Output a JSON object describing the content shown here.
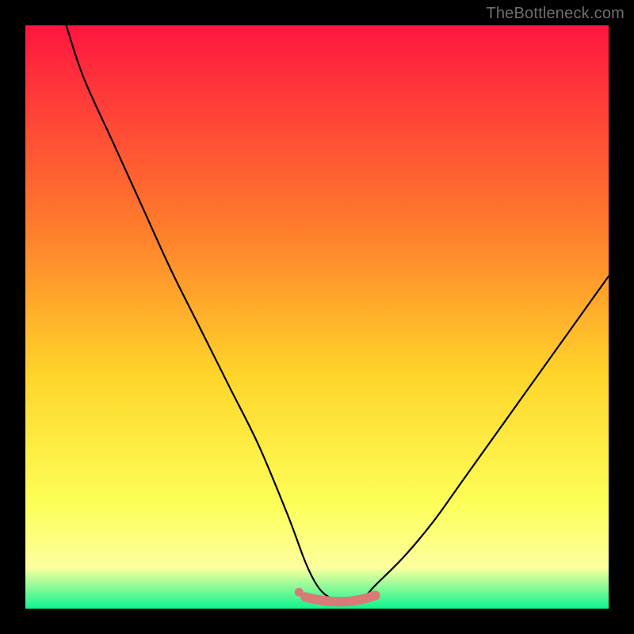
{
  "attribution": "TheBottleneck.com",
  "colors": {
    "gradient_top": "#ff163f",
    "gradient_mid1": "#ff7d2c",
    "gradient_mid2": "#ffd52a",
    "gradient_mid3": "#fdff58",
    "gradient_mid4": "#fdff9e",
    "gradient_bottom": "#0cf58f",
    "curve": "#000000",
    "accent": "#d97a76",
    "frame": "#000000"
  },
  "chart_data": {
    "type": "line",
    "title": "",
    "xlabel": "",
    "ylabel": "",
    "xlim": [
      0,
      100
    ],
    "ylim": [
      0,
      100
    ],
    "grid": false,
    "legend_position": "none",
    "series": [
      {
        "name": "bottleneck-curve",
        "x": [
          7,
          10,
          15,
          20,
          25,
          30,
          35,
          40,
          45,
          48,
          50,
          52,
          55,
          58,
          60,
          65,
          70,
          75,
          80,
          85,
          90,
          95,
          100
        ],
        "y": [
          100,
          91,
          80,
          69,
          58,
          48,
          38,
          28,
          16,
          8,
          4,
          2,
          1,
          2,
          4,
          9,
          15,
          22,
          29,
          36,
          43,
          50,
          57
        ]
      }
    ],
    "annotations": [
      {
        "name": "minimum-band",
        "type": "highlight",
        "x_range": [
          48,
          60
        ],
        "y": 2
      }
    ]
  }
}
